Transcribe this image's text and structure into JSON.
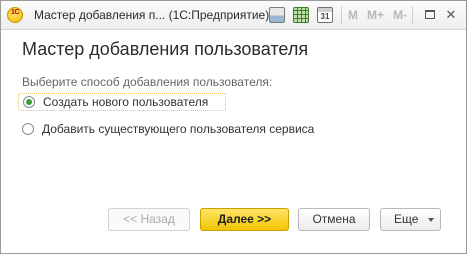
{
  "window": {
    "title": "Мастер добавления п...  (1С:Предприятие)",
    "logo_text": "1С",
    "calendar_day": "31",
    "memory_buttons": [
      "M",
      "M+",
      "M-"
    ],
    "minimize_label": "—",
    "close_label": "✕"
  },
  "wizard": {
    "heading": "Мастер добавления пользователя",
    "prompt": "Выберите способ добавления пользователя:",
    "options": [
      {
        "label": "Создать нового пользователя",
        "selected": true
      },
      {
        "label": "Добавить существующего пользователя сервиса",
        "selected": false
      }
    ]
  },
  "buttons": {
    "back": "<< Назад",
    "next": "Далее >>",
    "cancel": "Отмена",
    "more": "Еще"
  },
  "colors": {
    "accent_yellow": "#f2c500",
    "radio_selected": "#3a9e3a"
  }
}
